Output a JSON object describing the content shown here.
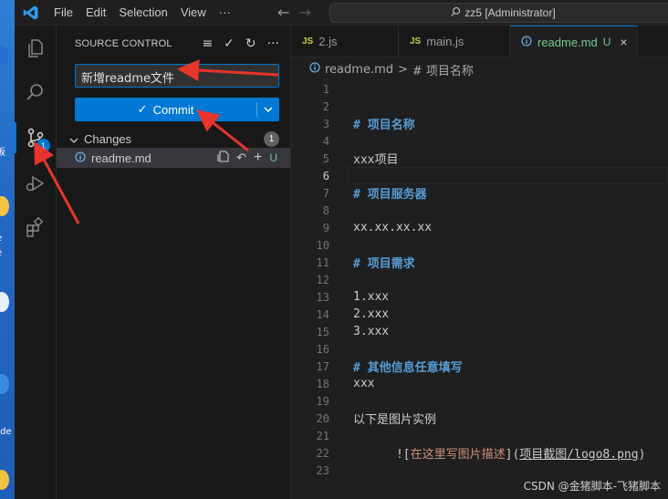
{
  "window": {
    "menu": [
      "File",
      "Edit",
      "Selection",
      "View",
      "···"
    ],
    "search_text": "zz5 [Administrator]"
  },
  "desktop_labels": [
    "板",
    "e",
    "e",
    "ode"
  ],
  "activity_bar": {
    "scm_badge": "1"
  },
  "source_control": {
    "title": "SOURCE CONTROL",
    "message_value": "新增readme文件",
    "commit_label": "Commit",
    "changes_label": "Changes",
    "changes_count": "1",
    "file_name": "readme.md",
    "file_status": "U"
  },
  "tabs": [
    {
      "label": "2.js",
      "type": "JS"
    },
    {
      "label": "main.js",
      "type": "JS"
    },
    {
      "label": "readme.md",
      "status": "U"
    }
  ],
  "breadcrumb": {
    "file": "readme.md",
    "sep": ">",
    "symbol": "# 项目名称"
  },
  "editor": {
    "current_line": 6,
    "lines": [
      {
        "n": "1",
        "text": "",
        "style": "plain"
      },
      {
        "n": "2",
        "text": "",
        "style": "plain"
      },
      {
        "n": "3",
        "text": "# 项目名称",
        "style": "heading"
      },
      {
        "n": "4",
        "text": "",
        "style": "plain"
      },
      {
        "n": "5",
        "text": "xxx项目",
        "style": "plain"
      },
      {
        "n": "6",
        "text": "",
        "style": "plain"
      },
      {
        "n": "7",
        "text": "# 项目服务器",
        "style": "heading"
      },
      {
        "n": "8",
        "text": "",
        "style": "plain"
      },
      {
        "n": "9",
        "text": "xx.xx.xx.xx",
        "style": "plain"
      },
      {
        "n": "10",
        "text": "",
        "style": "plain"
      },
      {
        "n": "11",
        "text": "# 项目需求",
        "style": "heading"
      },
      {
        "n": "12",
        "text": "",
        "style": "plain"
      },
      {
        "n": "13",
        "text": "1.xxx",
        "style": "plain"
      },
      {
        "n": "14",
        "text": "2.xxx",
        "style": "plain"
      },
      {
        "n": "15",
        "text": "3.xxx",
        "style": "plain"
      },
      {
        "n": "16",
        "text": "",
        "style": "plain"
      },
      {
        "n": "17",
        "text": "# 其他信息任意填写",
        "style": "heading"
      },
      {
        "n": "18",
        "text": "xxx",
        "style": "plain"
      },
      {
        "n": "19",
        "text": "",
        "style": "plain"
      },
      {
        "n": "20",
        "text": "以下是图片实例",
        "style": "plain"
      },
      {
        "n": "21",
        "text": "",
        "style": "plain"
      },
      {
        "n": "22",
        "text": "![在这里写图片描述](项目截图/logo8.png)",
        "style": "link"
      },
      {
        "n": "23",
        "text": "",
        "style": "plain"
      }
    ],
    "link_parts": {
      "open": "![",
      "alt": "在这里写图片描述",
      "mid": "](",
      "url": "项目截图/logo8.png",
      "close": ")"
    }
  },
  "watermark": "CSDN @金猪脚本-飞猪脚本",
  "colors": {
    "accent": "#0078d4",
    "annotation": "#e8352b",
    "untracked": "#73c991"
  }
}
